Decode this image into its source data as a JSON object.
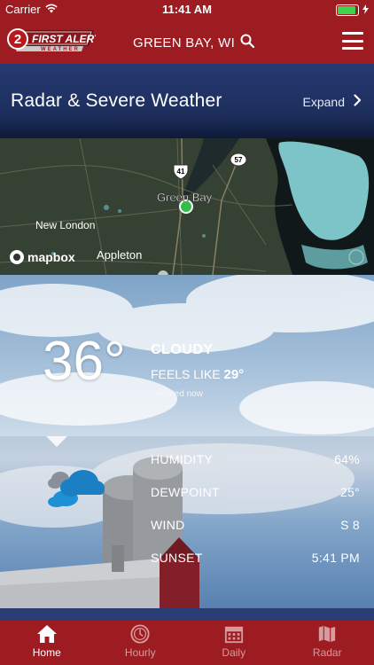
{
  "status": {
    "carrier": "Carrier",
    "time": "11:41 AM"
  },
  "header": {
    "logo_text": "FIRST ALERT",
    "logo_sub": "WEATHER",
    "logo_number": "2",
    "location": "GREEN BAY, WI"
  },
  "radar": {
    "title": "Radar & Severe Weather",
    "expand_label": "Expand"
  },
  "map": {
    "labels": {
      "green_bay": "Green Bay",
      "new_london": "New London",
      "appleton": "Appleton",
      "hwy41": "41",
      "hwy57": "57",
      "attribution": "mapbox"
    }
  },
  "current": {
    "temp": "36°",
    "condition": "CLOUDY",
    "feels_label": "FEELS LIKE",
    "feels_value": "29°",
    "updated": "Updated now",
    "icon": "cloudy-icon"
  },
  "details": [
    {
      "label": "HUMIDITY",
      "value": "64%"
    },
    {
      "label": "DEWPOINT",
      "value": "25°"
    },
    {
      "label": "WIND",
      "value": "S 8"
    },
    {
      "label": "SUNSET",
      "value": "5:41 PM"
    }
  ],
  "tabs": [
    {
      "label": "Home",
      "icon": "home-icon"
    },
    {
      "label": "Hourly",
      "icon": "clock-icon"
    },
    {
      "label": "Daily",
      "icon": "calendar-icon"
    },
    {
      "label": "Radar",
      "icon": "map-icon"
    }
  ],
  "colors": {
    "brand_red": "#9d1c22",
    "navy": "#1d2e5c",
    "battery_green": "#3cd34d",
    "map_marker": "#2fbf4a"
  }
}
